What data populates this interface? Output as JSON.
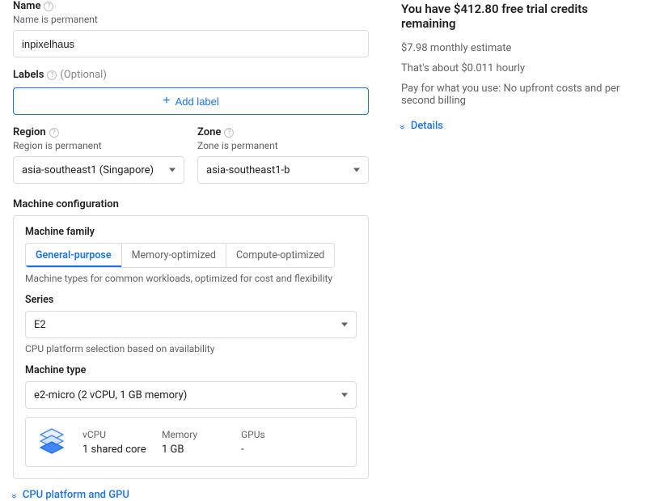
{
  "name": {
    "label": "Name",
    "sub": "Name is permanent",
    "value": "inpixelhaus"
  },
  "labels": {
    "label": "Labels",
    "optional": "(Optional)",
    "add_button": "Add label"
  },
  "region": {
    "label": "Region",
    "sub": "Region is permanent",
    "value": "asia-southeast1 (Singapore)"
  },
  "zone": {
    "label": "Zone",
    "sub": "Zone is permanent",
    "value": "asia-southeast1-b"
  },
  "machine_config": {
    "heading": "Machine configuration",
    "family_label": "Machine family",
    "tabs": {
      "general": "General-purpose",
      "memory": "Memory-optimized",
      "compute": "Compute-optimized"
    },
    "family_desc": "Machine types for common workloads, optimized for cost and flexibility",
    "series_label": "Series",
    "series_value": "E2",
    "series_desc": "CPU platform selection based on availability",
    "type_label": "Machine type",
    "type_value": "e2-micro (2 vCPU, 1 GB memory)",
    "specs": {
      "vcpu_label": "vCPU",
      "vcpu_value": "1 shared core",
      "mem_label": "Memory",
      "mem_value": "1 GB",
      "gpu_label": "GPUs",
      "gpu_value": "-"
    }
  },
  "cpu_gpu_expand": "CPU platform and GPU",
  "right": {
    "headline": "You have $412.80 free trial credits remaining",
    "monthly": "$7.98 monthly estimate",
    "hourly": "That's about $0.011 hourly",
    "payg": "Pay for what you use: No upfront costs and per second billing",
    "details": "Details"
  }
}
